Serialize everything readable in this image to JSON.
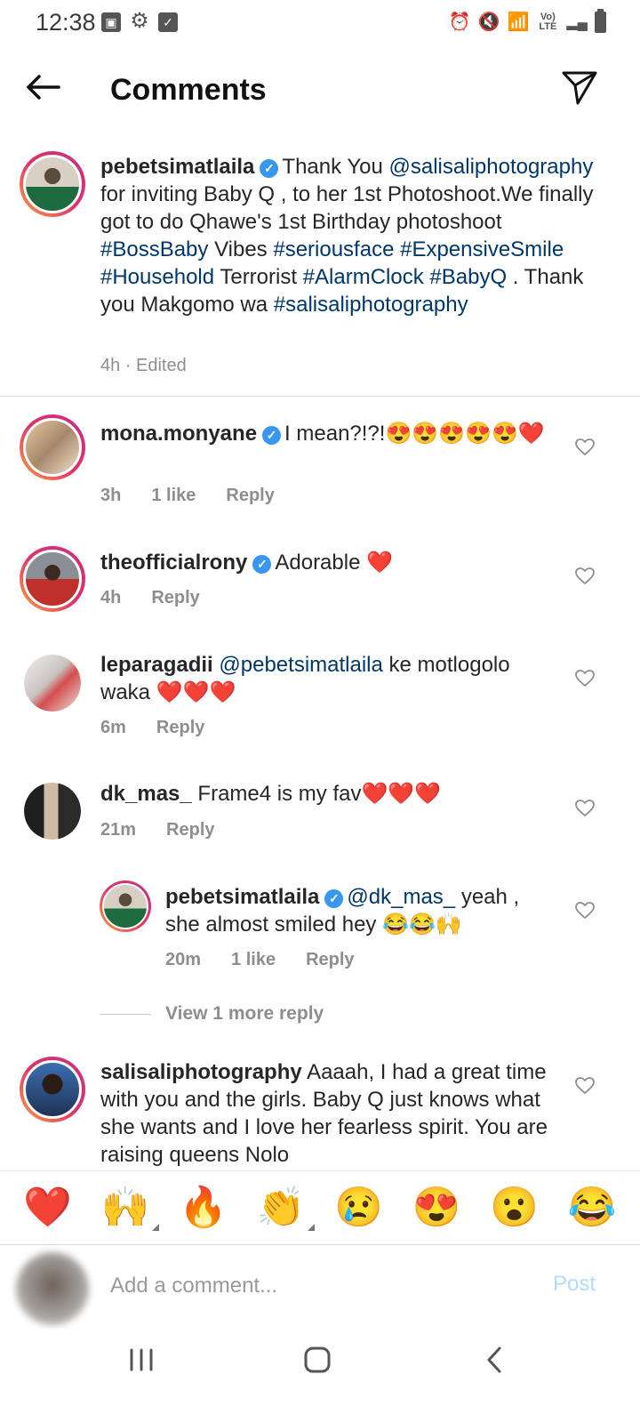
{
  "status_bar": {
    "time": "12:38",
    "right_glyph_label": "Vo) LTE"
  },
  "header": {
    "title": "Comments"
  },
  "caption": {
    "username": "pebetsimatlaila",
    "verified": true,
    "text_parts": [
      {
        "t": "Thank You ",
        "link": false
      },
      {
        "t": "@salisaliphotography",
        "link": true
      },
      {
        "t": " for inviting  Baby Q , to her 1st Photoshoot.We finally got to do Qhawe's 1st Birthday photoshoot ",
        "link": false
      },
      {
        "t": "#BossBaby",
        "link": true
      },
      {
        "t": " Vibes ",
        "link": false
      },
      {
        "t": "#seriousface",
        "link": true
      },
      {
        "t": " ",
        "link": false
      },
      {
        "t": "#ExpensiveSmile",
        "link": true
      },
      {
        "t": " ",
        "link": false
      },
      {
        "t": "#Household",
        "link": true
      },
      {
        "t": " Terrorist  ",
        "link": false
      },
      {
        "t": "#AlarmClock",
        "link": true
      },
      {
        "t": " ",
        "link": false
      },
      {
        "t": "#BabyQ",
        "link": true
      },
      {
        "t": " . Thank you Makgomo wa ",
        "link": false
      },
      {
        "t": "#salisaliphotography",
        "link": true
      }
    ],
    "meta": "4h · Edited"
  },
  "comments": [
    {
      "username": "mona.monyane",
      "verified": true,
      "text": "I mean?!?!😍😍😍😍😍❤️",
      "time": "3h",
      "likes": "1 like",
      "reply": "Reply"
    },
    {
      "username": "theofficialrony",
      "verified": true,
      "text": "Adorable ❤️",
      "time": "4h",
      "likes": "",
      "reply": "Reply"
    },
    {
      "username": "leparagadii",
      "verified": false,
      "mention": "@pebetsimatlaila",
      "text": " ke motlogolo waka ❤️❤️❤️",
      "time": "6m",
      "likes": "",
      "reply": "Reply"
    },
    {
      "username": "dk_mas_",
      "verified": false,
      "text": "Frame4 is my fav❤️❤️❤️",
      "time": "21m",
      "likes": "",
      "reply": "Reply"
    }
  ],
  "reply_comment": {
    "username": "pebetsimatlaila",
    "verified": true,
    "mention": "@dk_mas_",
    "text": " yeah , she almost smiled hey 😂😂🙌",
    "time": "20m",
    "likes": "1 like",
    "reply": "Reply"
  },
  "view_more": "View 1 more reply",
  "last_comment": {
    "username": "salisaliphotography",
    "verified": false,
    "text": "Aaaah, I had a great time with you and the girls. Baby Q just knows what she wants and I love her fearless spirit. You are raising queens Nolo"
  },
  "emoji_bar": [
    "❤️",
    "🙌",
    "🔥",
    "👏",
    "😢",
    "😍",
    "😮",
    "😂"
  ],
  "input": {
    "placeholder": "Add a comment...",
    "post_label": "Post"
  }
}
